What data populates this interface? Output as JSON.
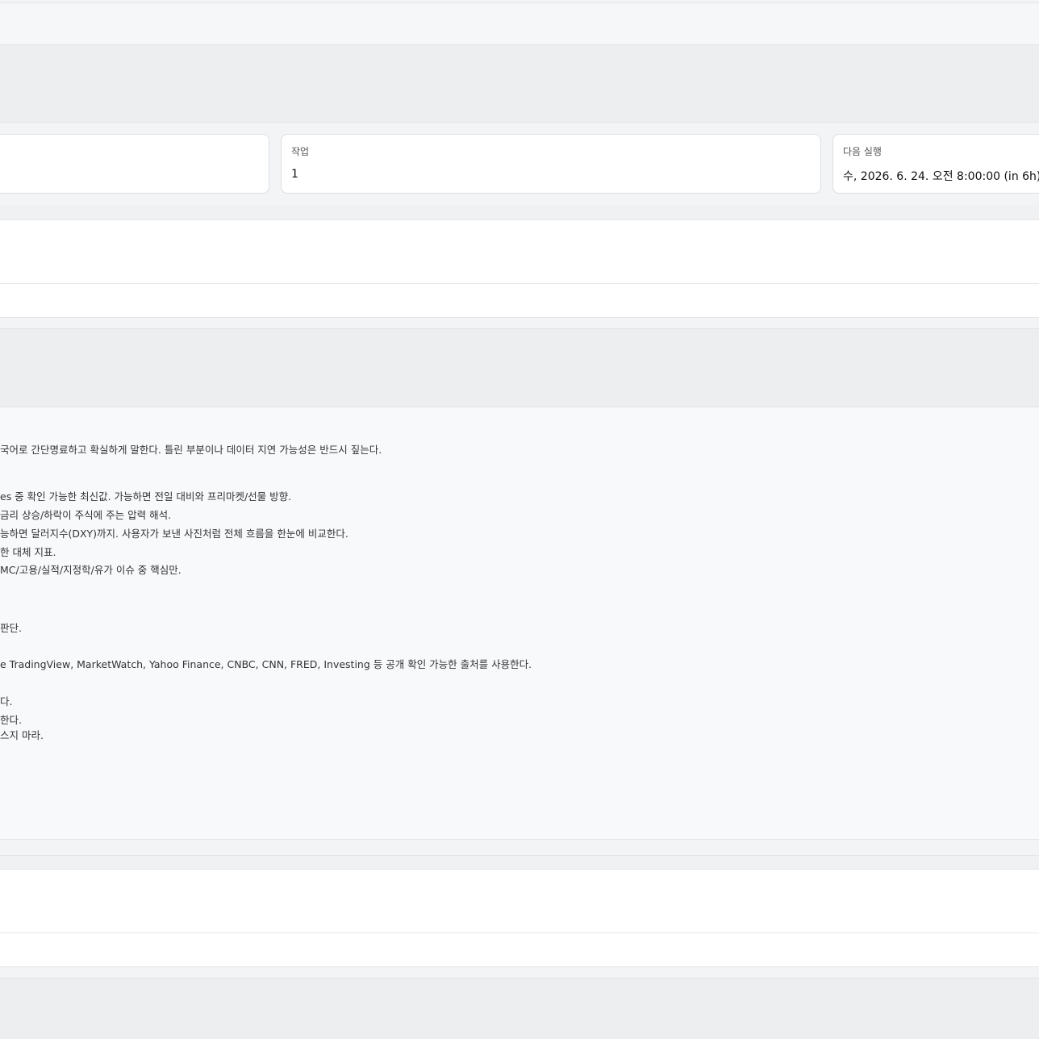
{
  "stats": {
    "jobs": {
      "label": "작업",
      "value": "1"
    },
    "next_run": {
      "label": "다음 실행",
      "value": "수, 2026. 6. 24. 오전 8:00:00 (in 6h)"
    }
  },
  "prompt_lines": [
    "국어로 간단명료하고 확실하게 말한다. 틀린 부분이나 데이터 지연 가능성은 반드시 짚는다.",
    "es 중 확인 가능한 최신값. 가능하면 전일 대비와 프리마켓/선물 방향.",
    "금리 상승/하락이 주식에 주는 압력 해석.",
    "능하면 달러지수(DXY)까지. 사용자가 보낸 사진처럼 전체 흐름을 한눈에 비교한다.",
    "한 대체 지표.",
    "MC/고용/실적/지정학/유가 이슈 중 핵심만.",
    "판단.",
    "e TradingView, MarketWatch, Yahoo Finance, CNBC, CNN, FRED, Investing 등 공개 확인 가능한 출처를 사용한다.",
    "다.",
    "한다.",
    "스지 마라."
  ]
}
